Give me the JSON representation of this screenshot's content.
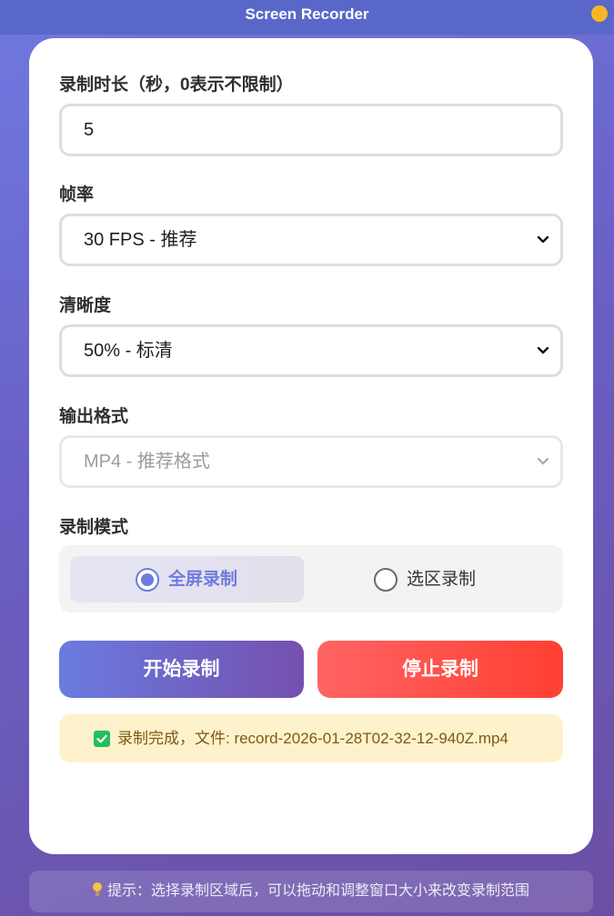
{
  "window": {
    "title": "Screen Recorder"
  },
  "form": {
    "duration": {
      "label": "录制时长（秒，0表示不限制）",
      "value": "5"
    },
    "framerate": {
      "label": "帧率",
      "selected": "30 FPS - 推荐"
    },
    "quality": {
      "label": "清晰度",
      "selected": "50% - 标清"
    },
    "format": {
      "label": "输出格式",
      "selected": "MP4 - 推荐格式",
      "disabled": true
    },
    "mode": {
      "label": "录制模式",
      "options": [
        {
          "label": "全屏录制",
          "selected": true
        },
        {
          "label": "选区录制",
          "selected": false
        }
      ]
    }
  },
  "buttons": {
    "start": "开始录制",
    "stop": "停止录制"
  },
  "status": {
    "text": "录制完成，文件: record-2026-01-28T02-32-12-940Z.mp4",
    "icon": "check-icon"
  },
  "tip": {
    "text": "提示：选择录制区域后，可以拖动和调整窗口大小来改变录制范围",
    "icon": "lightbulb-icon"
  },
  "colors": {
    "accent": "#6c7ce0",
    "start_gradient": [
      "#6a7be0",
      "#7550ad"
    ],
    "stop_gradient": [
      "#ff6464",
      "#ff3f32"
    ],
    "success": "#21c05c",
    "status_bg": "#fef2cd"
  }
}
